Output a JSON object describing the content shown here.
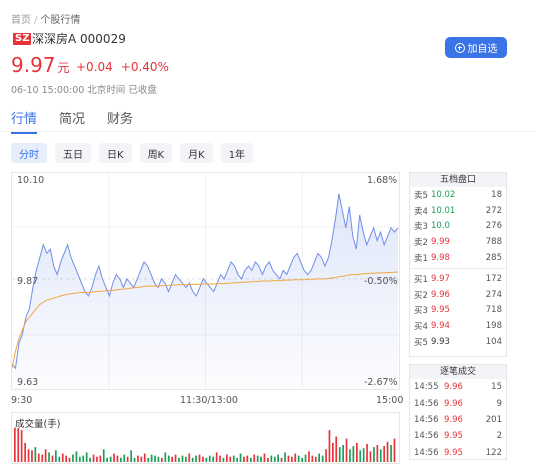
{
  "breadcrumb": {
    "home": "首页",
    "sep": "/",
    "current": "个股行情"
  },
  "stock": {
    "exchange": "SZ",
    "name_code": "深深房A 000029",
    "price": "9.97",
    "unit": "元",
    "change": "+0.04",
    "change_pct": "+0.40%",
    "time_status": "06-10 15:00:00 北京时间 已收盘"
  },
  "watch_button": "加自选",
  "tabs": [
    "行情",
    "简况",
    "财务"
  ],
  "periods": [
    "分时",
    "五日",
    "日K",
    "周K",
    "月K",
    "1年"
  ],
  "colors": {
    "up": "#e8333a",
    "down": "#1a9e5a",
    "accent": "#3a73e6",
    "price_line": "#6f8ee8",
    "avg_line": "#f0a640"
  },
  "chart": {
    "price_labels": {
      "top": "10.10",
      "mid": "9.87",
      "bottom": "9.63"
    },
    "pct_labels": {
      "top": "1.68%",
      "mid": "-0.50%",
      "bottom": "-2.67%"
    },
    "time_labels": [
      "9:30",
      "11:30/13:00",
      "15:00"
    ],
    "volume_title": "成交量(手)"
  },
  "chart_data": {
    "type": "line",
    "y_range": [
      9.63,
      10.1
    ],
    "reference_price": 9.87,
    "series": [
      {
        "values": [
          9.67,
          9.66,
          9.72,
          9.74,
          9.78,
          9.8,
          9.85,
          9.89,
          9.92,
          9.95,
          9.93,
          9.94,
          9.9,
          9.88,
          9.91,
          9.93,
          9.95,
          9.92,
          9.9,
          9.88,
          9.86,
          9.84,
          9.83,
          9.85,
          9.88,
          9.9,
          9.87,
          9.85,
          9.83,
          9.86,
          9.88,
          9.87,
          9.85,
          9.87,
          9.86,
          9.85,
          9.87,
          9.89,
          9.91,
          9.9,
          9.88,
          9.86,
          9.85,
          9.87,
          9.86,
          9.84,
          9.86,
          9.88,
          9.87,
          9.86,
          9.85,
          9.86,
          9.84,
          9.83,
          9.85,
          9.87,
          9.86,
          9.85,
          9.84,
          9.86,
          9.88,
          9.87,
          9.89,
          9.91,
          9.9,
          9.88,
          9.87,
          9.89,
          9.9,
          9.89,
          9.91,
          9.9,
          9.88,
          9.9,
          9.91,
          9.89,
          9.88,
          9.87,
          9.89,
          9.88,
          9.9,
          9.92,
          9.93,
          9.91,
          9.89,
          9.88,
          9.89,
          9.91,
          9.93,
          9.92,
          9.9,
          9.92,
          9.96,
          10.01,
          10.07,
          10.03,
          9.99,
          10.04,
          9.97,
          9.94,
          10.02,
          9.98,
          9.95,
          9.97,
          9.99,
          9.96,
          9.98,
          9.95,
          9.97,
          9.99,
          9.98,
          9.99
        ]
      },
      {
        "values": [
          9.66,
          9.7,
          9.73,
          9.75,
          9.77,
          9.78,
          9.79,
          9.8,
          9.81,
          9.815,
          9.82,
          9.822,
          9.825,
          9.827,
          9.83,
          9.832,
          9.834,
          9.835,
          9.836,
          9.837,
          9.838,
          9.838,
          9.838,
          9.839,
          9.84,
          9.841,
          9.841,
          9.842,
          9.843,
          9.843,
          9.844,
          9.845,
          9.846,
          9.847,
          9.848,
          9.849,
          9.85,
          9.851,
          9.852,
          9.853,
          9.853,
          9.853,
          9.853,
          9.854,
          9.854,
          9.855,
          9.855,
          9.856,
          9.856,
          9.856,
          9.856,
          9.857,
          9.857,
          9.857,
          9.857,
          9.858,
          9.858,
          9.858,
          9.858,
          9.859,
          9.859,
          9.859,
          9.86,
          9.86,
          9.861,
          9.861,
          9.862,
          9.862,
          9.863,
          9.863,
          9.864,
          9.864,
          9.865,
          9.865,
          9.865,
          9.866,
          9.866,
          9.866,
          9.867,
          9.867,
          9.867,
          9.868,
          9.868,
          9.868,
          9.868,
          9.869,
          9.869,
          9.869,
          9.87,
          9.87,
          9.87,
          9.871,
          9.872,
          9.873,
          9.875,
          9.876,
          9.877,
          9.879,
          9.88,
          9.88,
          9.881,
          9.882,
          9.882,
          9.883,
          9.883,
          9.884,
          9.884,
          9.884,
          9.885,
          9.885,
          9.886,
          9.886
        ]
      }
    ],
    "volume": [
      520,
      180,
      150,
      90,
      60,
      55,
      70,
      40,
      35,
      60,
      45,
      30,
      55,
      25,
      40,
      30,
      20,
      35,
      50,
      25,
      30,
      45,
      20,
      35,
      25,
      30,
      60,
      20,
      25,
      40,
      30,
      20,
      35,
      25,
      55,
      20,
      30,
      25,
      40,
      20,
      35,
      30,
      25,
      20,
      45,
      30,
      25,
      35,
      20,
      30,
      25,
      40,
      20,
      30,
      35,
      25,
      20,
      30,
      25,
      45,
      30,
      20,
      35,
      25,
      30,
      20,
      40,
      25,
      30,
      20,
      35,
      30,
      25,
      40,
      20,
      30,
      25,
      35,
      20,
      45,
      30,
      25,
      40,
      30,
      20,
      35,
      50,
      30,
      25,
      40,
      30,
      60,
      150,
      90,
      120,
      70,
      80,
      110,
      60,
      75,
      90,
      55,
      65,
      85,
      50,
      70,
      80,
      60,
      75,
      95,
      80,
      110
    ],
    "volume_up": [
      true,
      true,
      true,
      true,
      true,
      true,
      false,
      true,
      true,
      true,
      false,
      true,
      false,
      false,
      true,
      true,
      true,
      false,
      false,
      false,
      false,
      false,
      false,
      true,
      true,
      true,
      false,
      false,
      false,
      true,
      true,
      false,
      false,
      true,
      false,
      false,
      true,
      true,
      true,
      false,
      false,
      false,
      false,
      true,
      false,
      false,
      true,
      true,
      false,
      false,
      false,
      true,
      false,
      false,
      true,
      true,
      false,
      false,
      false,
      true,
      true,
      false,
      true,
      true,
      false,
      false,
      false,
      true,
      true,
      false,
      true,
      false,
      false,
      true,
      true,
      false,
      false,
      false,
      true,
      false,
      true,
      true,
      true,
      false,
      false,
      false,
      true,
      true,
      true,
      false,
      false,
      true,
      true,
      true,
      true,
      false,
      false,
      true,
      false,
      false,
      true,
      false,
      false,
      true,
      true,
      false,
      true,
      false,
      true,
      true,
      false,
      true
    ]
  },
  "order_book": {
    "title": "五档盘口",
    "asks": [
      {
        "label": "卖5",
        "price": "10.02",
        "volume": "18",
        "dir": "up"
      },
      {
        "label": "卖4",
        "price": "10.01",
        "volume": "272",
        "dir": "up"
      },
      {
        "label": "卖3",
        "price": "10.0",
        "volume": "276",
        "dir": "up"
      },
      {
        "label": "卖2",
        "price": "9.99",
        "volume": "788",
        "dir": "down"
      },
      {
        "label": "卖1",
        "price": "9.98",
        "volume": "285",
        "dir": "down"
      }
    ],
    "bids": [
      {
        "label": "买1",
        "price": "9.97",
        "volume": "172",
        "dir": "down"
      },
      {
        "label": "买2",
        "price": "9.96",
        "volume": "274",
        "dir": "down"
      },
      {
        "label": "买3",
        "price": "9.95",
        "volume": "718",
        "dir": "down"
      },
      {
        "label": "买4",
        "price": "9.94",
        "volume": "198",
        "dir": "down"
      },
      {
        "label": "买5",
        "price": "9.93",
        "volume": "104",
        "dir": "flat"
      }
    ]
  },
  "ticks": {
    "title": "逐笔成交",
    "rows": [
      {
        "time": "14:55",
        "price": "9.96",
        "volume": "15"
      },
      {
        "time": "14:56",
        "price": "9.96",
        "volume": "9"
      },
      {
        "time": "14:56",
        "price": "9.96",
        "volume": "201"
      },
      {
        "time": "14:56",
        "price": "9.95",
        "volume": "2"
      },
      {
        "time": "14:56",
        "price": "9.95",
        "volume": "122"
      }
    ]
  }
}
